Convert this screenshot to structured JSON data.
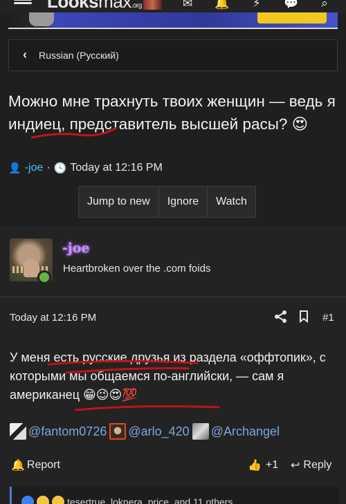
{
  "header": {
    "logo_bold": "Looks",
    "logo_light": "max",
    "logo_suffix": ".org"
  },
  "breadcrumb": {
    "label": "Russian (Русский)"
  },
  "thread": {
    "title_part1": "Можно мне трахнуть твоих женщин — ведь я индиец, представитель высшей расы? ",
    "title_emoji": "😍",
    "author": "-joe",
    "separator": "·",
    "time": "Today at 12:16 PM"
  },
  "buttons": {
    "jump": "Jump to new",
    "ignore": "Ignore",
    "watch": "Watch"
  },
  "post": {
    "username": "-joe",
    "user_title": "Heartbroken over the .com foids",
    "time": "Today at 12:16 PM",
    "number": "#1",
    "body": "У меня есть русские друзья из раздела «оффтопик», с которыми мы общаемся по-английски, — сам я американец ",
    "body_emojis": "😁😉😍💯",
    "mentions": [
      "@fantom0726",
      "@arlo_420",
      "@Archangel"
    ],
    "report": "Report",
    "likes": "+1",
    "reply": "Reply",
    "reactions_text": "tesertrue, loknera_price, and 11 others"
  },
  "colors": {
    "background": "#1f1f1f",
    "username": "#c790f0",
    "link": "#4fc3f7",
    "mention": "#7aa7e0",
    "underline": "#c0141a",
    "online": "#67b544"
  }
}
